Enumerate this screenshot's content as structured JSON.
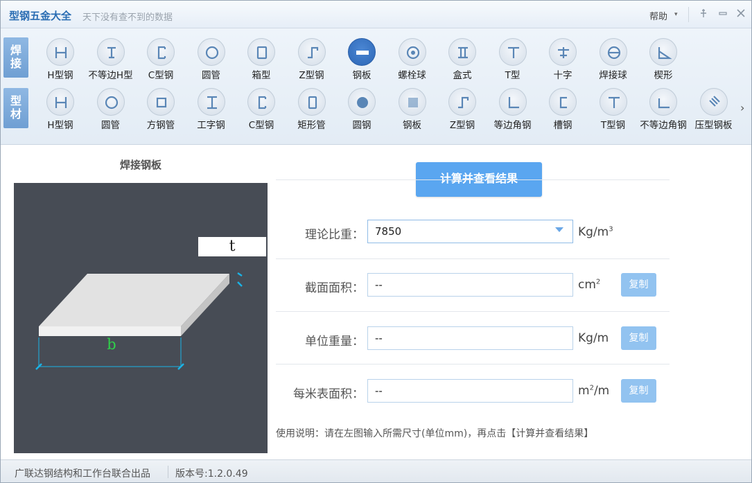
{
  "app": {
    "title": "型钢五金大全",
    "subtitle": "天下没有查不到的数据"
  },
  "titlebar": {
    "help_label": "帮助",
    "help_caret": "▾",
    "pin_icon": "pin-icon",
    "minimize_icon": "minimize-icon",
    "close_icon": "close-icon"
  },
  "categories": [
    {
      "label_line1": "焊",
      "label_line2": "接"
    },
    {
      "label_line1": "型",
      "label_line2": "材"
    }
  ],
  "weld_tools": [
    {
      "label": "H型钢",
      "icon": "h-beam-icon"
    },
    {
      "label": "不等边H型",
      "icon": "unequal-h-icon"
    },
    {
      "label": "C型钢",
      "icon": "c-channel-icon"
    },
    {
      "label": "圆管",
      "icon": "round-pipe-icon"
    },
    {
      "label": "箱型",
      "icon": "box-section-icon"
    },
    {
      "label": "Z型钢",
      "icon": "z-section-icon"
    },
    {
      "label": "钢板",
      "icon": "steel-plate-icon",
      "active": true
    },
    {
      "label": "螺栓球",
      "icon": "bolt-ball-icon"
    },
    {
      "label": "盒式",
      "icon": "box-type-icon"
    },
    {
      "label": "T型",
      "icon": "t-section-icon"
    },
    {
      "label": "十字",
      "icon": "cross-section-icon"
    },
    {
      "label": "焊接球",
      "icon": "welded-ball-icon"
    },
    {
      "label": "楔形",
      "icon": "wedge-icon"
    }
  ],
  "profile_tools": [
    {
      "label": "H型钢",
      "icon": "h-beam-icon"
    },
    {
      "label": "圆管",
      "icon": "round-pipe-icon"
    },
    {
      "label": "方钢管",
      "icon": "square-tube-icon"
    },
    {
      "label": "工字钢",
      "icon": "i-beam-icon"
    },
    {
      "label": "C型钢",
      "icon": "c-channel-icon"
    },
    {
      "label": "矩形管",
      "icon": "rect-tube-icon"
    },
    {
      "label": "圆钢",
      "icon": "round-bar-icon"
    },
    {
      "label": "钢板",
      "icon": "steel-plate-icon"
    },
    {
      "label": "Z型钢",
      "icon": "z-section-icon"
    },
    {
      "label": "等边角钢",
      "icon": "equal-angle-icon"
    },
    {
      "label": "槽钢",
      "icon": "channel-icon"
    },
    {
      "label": "T型钢",
      "icon": "t-section-icon"
    },
    {
      "label": "不等边角钢",
      "icon": "unequal-angle-icon"
    },
    {
      "label": "压型钢板",
      "icon": "profiled-sheet-icon"
    }
  ],
  "next_arrow": "›",
  "panel": {
    "title": "焊接钢板",
    "dim_t": "t",
    "dim_b": "b"
  },
  "form": {
    "calc_button": "计算并查看结果",
    "density": {
      "label": "理论比重：",
      "value": "7850",
      "unit_base": "Kg/m",
      "unit_sup": "3"
    },
    "area": {
      "label": "截面面积：",
      "value": "--",
      "unit_base": "cm",
      "unit_sup": "2",
      "copy": "复制"
    },
    "weight": {
      "label": "单位重量：",
      "value": "--",
      "unit": "Kg/m",
      "copy": "复制"
    },
    "surface": {
      "label": "每米表面积：",
      "value": "--",
      "unit_base": "m",
      "unit_sup": "2",
      "unit_tail": "/m",
      "copy": "复制"
    },
    "usage": "使用说明：请在左图输入所需尺寸(单位mm)，再点击【计算并查看结果】"
  },
  "status": {
    "left": "广联达钢结构和工作台联合出品",
    "version": "版本号:1.2.0.49"
  },
  "colors": {
    "accent": "#5aa6f0",
    "copy_button": "#92c3f0",
    "diagram_bg": "#474c55",
    "dim_line": "#1ab3e6",
    "label_b": "#2fd24a"
  }
}
